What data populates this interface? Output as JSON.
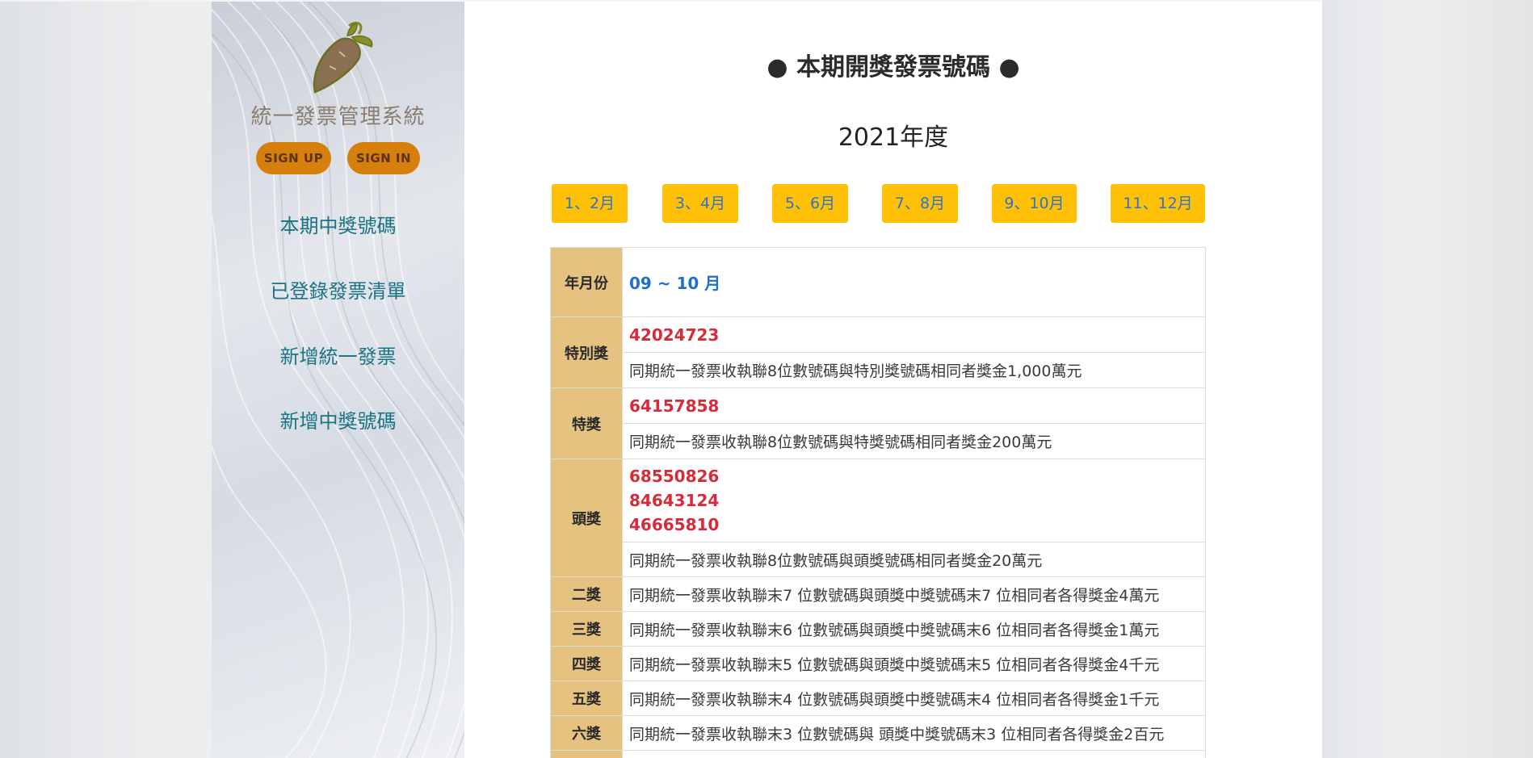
{
  "app": {
    "title": "統一發票管理系統",
    "sign_up": "SIGN UP",
    "sign_in": "SIGN IN"
  },
  "nav": [
    {
      "label": "本期中獎號碼"
    },
    {
      "label": "已登錄發票清單"
    },
    {
      "label": "新增統一發票"
    },
    {
      "label": "新增中獎號碼"
    }
  ],
  "main": {
    "title": "● 本期開獎發票號碼 ●",
    "year": "2021年度",
    "months": [
      "1、2月",
      "3、4月",
      "5、6月",
      "7、8月",
      "9、10月",
      "11、12月"
    ],
    "table": {
      "period_label": "年月份",
      "period_value": "09 ~ 10 月",
      "special": {
        "label": "特別獎",
        "number": "42024723",
        "desc": "同期統一發票收執聯8位數號碼與特別獎號碼相同者獎金1,000萬元"
      },
      "grand": {
        "label": "特獎",
        "number": "64157858",
        "desc": "同期統一發票收執聯8位數號碼與特獎號碼相同者獎金200萬元"
      },
      "first": {
        "label": "頭獎",
        "numbers": [
          "68550826",
          "84643124",
          "46665810"
        ],
        "desc": "同期統一發票收執聯8位數號碼與頭獎號碼相同者獎金20萬元"
      },
      "others": [
        {
          "label": "二獎",
          "desc": "同期統一發票收執聯末7 位數號碼與頭獎中獎號碼末7 位相同者各得獎金4萬元"
        },
        {
          "label": "三獎",
          "desc": "同期統一發票收執聯末6 位數號碼與頭獎中獎號碼末6 位相同者各得獎金1萬元"
        },
        {
          "label": "四獎",
          "desc": "同期統一發票收執聯末5 位數號碼與頭獎中獎號碼末5 位相同者各得獎金4千元"
        },
        {
          "label": "五獎",
          "desc": "同期統一發票收執聯末4 位數號碼與頭獎中獎號碼末4 位相同者各得獎金1千元"
        },
        {
          "label": "六獎",
          "desc": "同期統一發票收執聯末3 位數號碼與 頭獎中獎號碼末3 位相同者各得獎金2百元"
        }
      ]
    }
  },
  "colors": {
    "accent_orange": "#d67f0d",
    "month_button": "#ffc107",
    "label_bg": "#e6c281",
    "number_red": "#d62b3a",
    "nav_teal": "#1b7386"
  }
}
